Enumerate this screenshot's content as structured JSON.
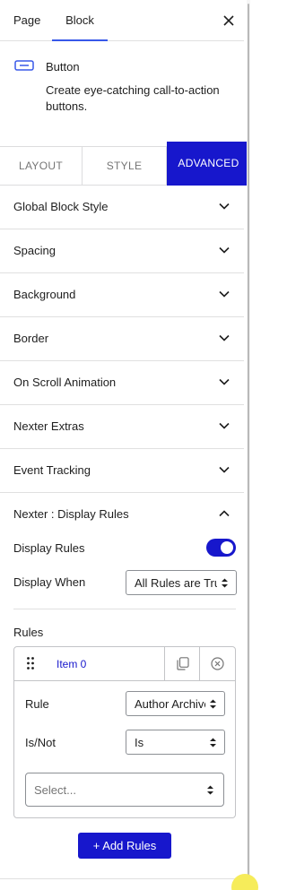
{
  "top_tabs": {
    "page": "Page",
    "block": "Block"
  },
  "block": {
    "name": "Button",
    "description": "Create eye-catching call-to-action buttons.",
    "icon": "button-icon"
  },
  "sub_tabs": {
    "layout": "LAYOUT",
    "style": "STYLE",
    "advanced": "ADVANCED",
    "active": "ADVANCED"
  },
  "panels": [
    "Global Block Style",
    "Spacing",
    "Background",
    "Border",
    "On Scroll Animation",
    "Nexter Extras",
    "Event Tracking",
    "Nexter : Display Rules"
  ],
  "display_rules": {
    "enabled_label": "Display Rules",
    "enabled": true,
    "when_label": "Display When",
    "when_value": "All Rules are True",
    "rules_label": "Rules",
    "item_label": "Item 0",
    "rule_label": "Rule",
    "rule_value": "Author Archive",
    "isnot_label": "Is/Not",
    "isnot_value": "Is",
    "value_placeholder": "Select...",
    "add_button": "+ Add Rules"
  },
  "colors": {
    "accent": "#1717cc",
    "tab_underline": "#3858e9"
  }
}
